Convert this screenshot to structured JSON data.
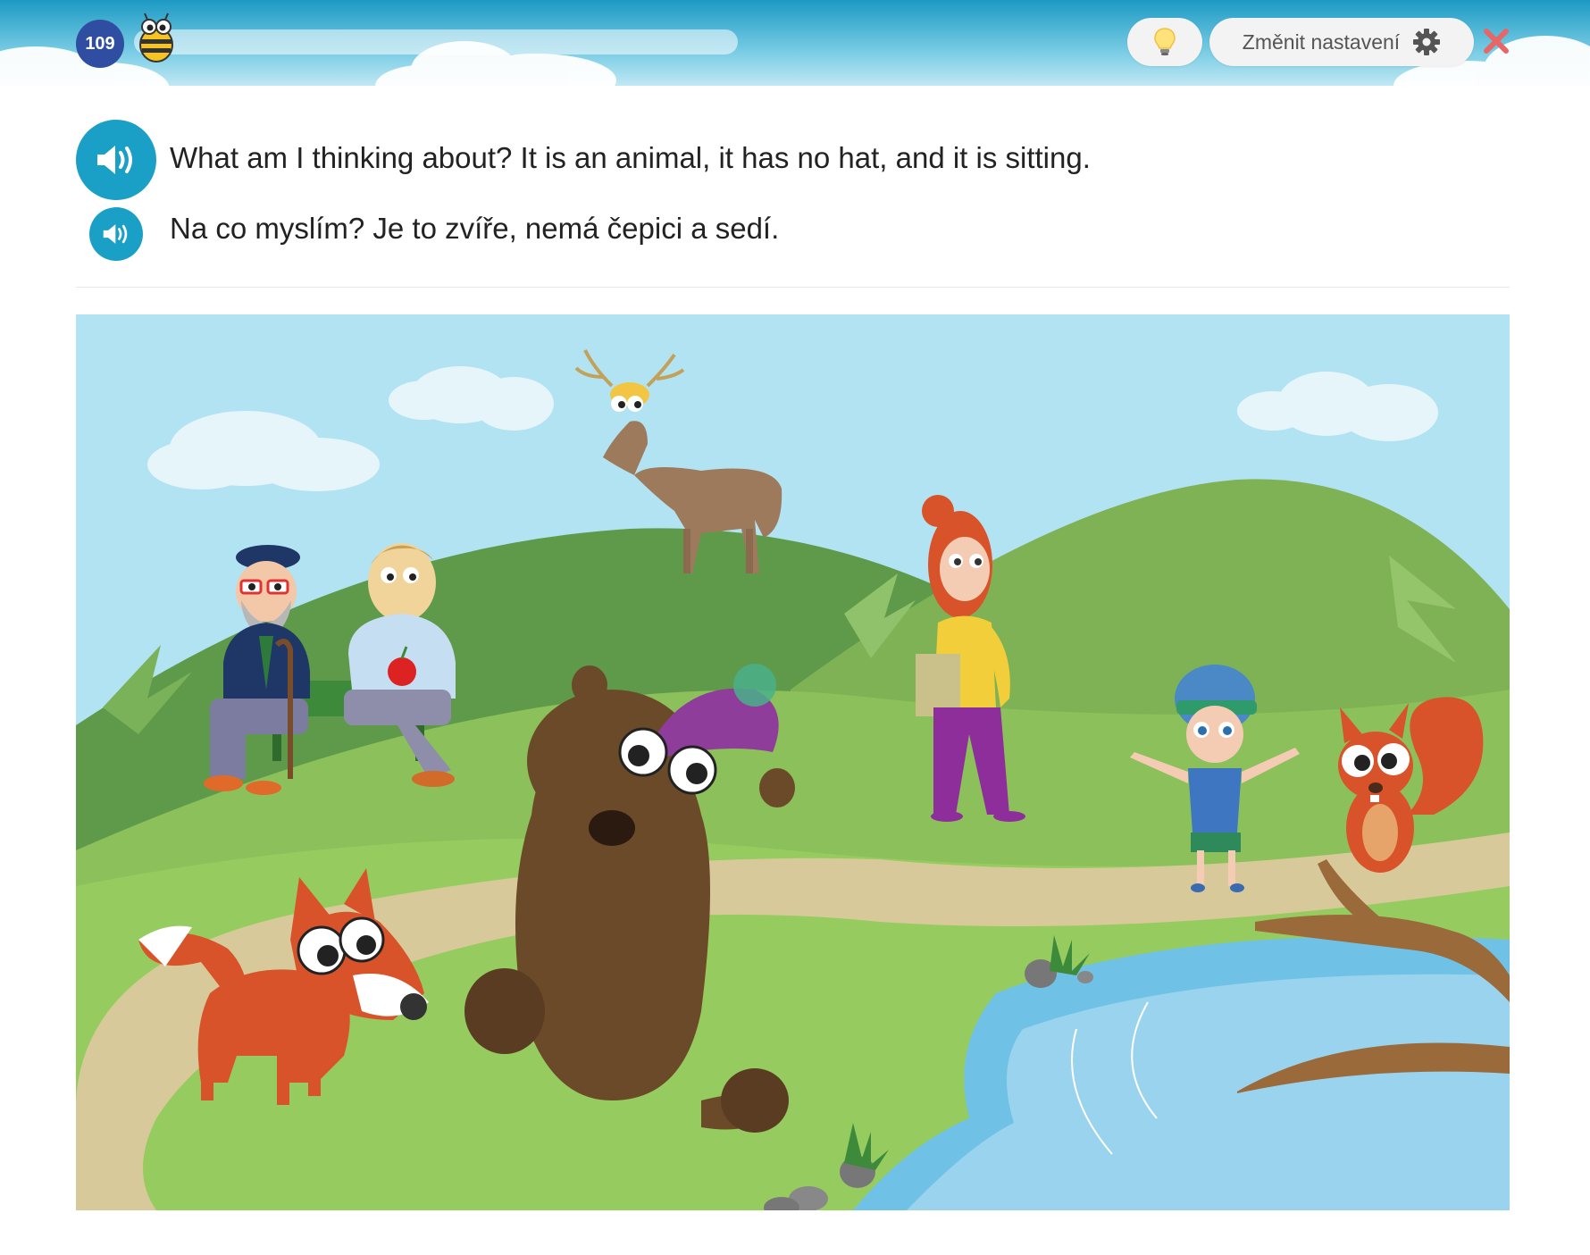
{
  "header": {
    "level": "109",
    "progress": 0.0,
    "settings_label": "Změnit nastavení",
    "icons": {
      "mascot": "bee-icon",
      "hint": "lightbulb-icon",
      "settings": "gear-icon",
      "close": "close-icon"
    }
  },
  "prompt": {
    "english": "What am I thinking about? It is an animal, it has no hat, and it is sitting.",
    "czech": "Na co myslím? Je to zvíře, nemá čepici a sedí.",
    "icons": {
      "audio": "speaker-icon"
    }
  },
  "scene": {
    "characters": [
      "deer",
      "old-man",
      "man-with-apple",
      "woman",
      "boy",
      "bear",
      "fox",
      "squirrel"
    ]
  },
  "colors": {
    "accent": "#1aa0c6",
    "level_badge": "#2f4ea2",
    "close": "#e86666",
    "sky": "#b2e3f2"
  }
}
